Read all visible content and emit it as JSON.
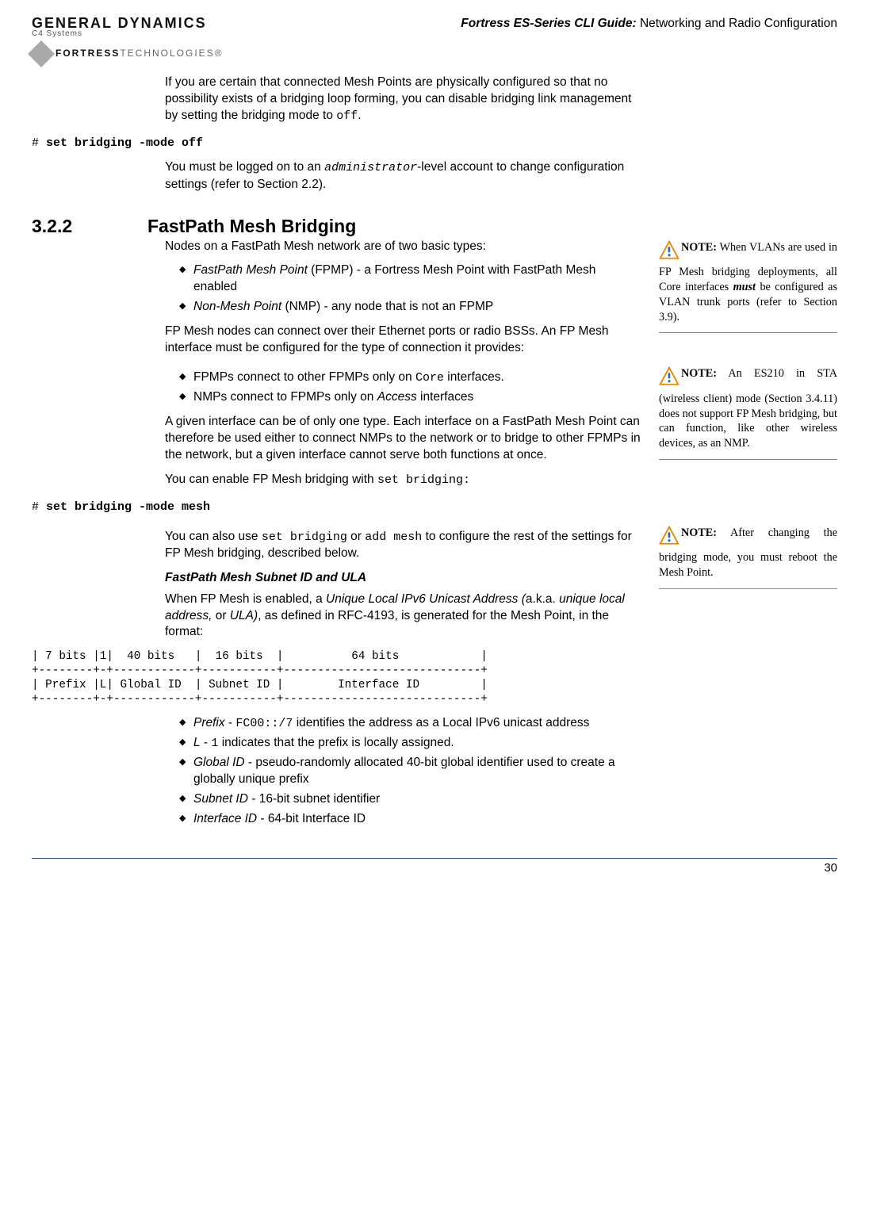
{
  "header": {
    "logo_top": "GENERAL DYNAMICS",
    "logo_sub": "C4 Systems",
    "logo2a": "FORTRESS",
    "logo2b": "TECHNOLOGIES®",
    "title_italic": "Fortress ES-Series CLI Guide:",
    "title_rest": " Networking and Radio Configuration"
  },
  "body": {
    "p1a": "If you are certain that connected Mesh Points are physically configured so that no possibility exists of a bridging loop forming, you can disable bridging link management by setting the bridging mode to ",
    "p1b": "off",
    "p1c": ".",
    "cmd1_prompt": "# ",
    "cmd1_cmd": "set bridging -mode off",
    "p2a": "You must be logged on to an ",
    "p2b": "administrator",
    "p2c": "-level account to change configuration settings (refer to Section 2.2).",
    "secnum": "3.2.2",
    "sectitle": "FastPath Mesh Bridging",
    "p3": "Nodes on a FastPath Mesh network are of two basic types:",
    "li1a": "FastPath Mesh Point",
    "li1b": " (FPMP) - a Fortress Mesh Point with FastPath Mesh enabled",
    "li2a": "Non-Mesh Point",
    "li2b": " (NMP) - any node that is not an FPMP",
    "p4": "FP Mesh nodes can connect over their Ethernet ports or radio BSSs. An FP Mesh interface must be configured for the type of connection it provides:",
    "li3a": "FPMPs connect to other FPMPs only on ",
    "li3b": "Core",
    "li3c": " interfaces.",
    "li4a": "NMPs connect to FPMPs only on ",
    "li4b": "Access",
    "li4c": " interfaces",
    "p5": "A given interface can be of only one type. Each interface on a FastPath Mesh Point can therefore be used either to connect NMPs to the network or to bridge to other FPMPs in the network, but a given interface cannot serve both functions at once.",
    "p6a": "You can enable FP Mesh bridging with ",
    "p6b": "set bridging:",
    "cmd2_prompt": "# ",
    "cmd2_cmd": "set bridging -mode mesh",
    "p7a": "You can also use ",
    "p7b": "set bridging",
    "p7c": " or ",
    "p7d": "add mesh",
    "p7e": " to configure the rest of the settings for FP Mesh bridging, described below.",
    "subhead1": "FastPath Mesh Subnet ID and ULA",
    "p8a": "When FP Mesh is enabled, a ",
    "p8b": "Unique Local IPv6 Unicast Address (",
    "p8c": "a.k.a. ",
    "p8d": "unique local address,",
    "p8e": " or ",
    "p8f": "ULA)",
    "p8g": ", as defined in RFC-4193, is generated for the Mesh Point, in the format:",
    "ascii": "| 7 bits |1|  40 bits   |  16 bits  |          64 bits            |\n+--------+-+------------+-----------+-----------------------------+\n| Prefix |L| Global ID  | Subnet ID |        Interface ID         |\n+--------+-+------------+-----------+-----------------------------+",
    "li5a": "Prefix",
    "li5b": " - ",
    "li5c": "FC00::/7",
    "li5d": " identifies the address as a Local IPv6 unicast address",
    "li6a": "L",
    "li6b": " - ",
    "li6c": "1",
    "li6d": " indicates that the prefix is locally assigned.",
    "li7a": "Global ID",
    "li7b": " - pseudo-randomly allocated 40-bit global identifier used to create a globally unique prefix",
    "li8a": "Subnet ID",
    "li8b": " - 16-bit subnet identifier",
    "li9a": "Interface ID",
    "li9b": " - 64-bit Interface ID"
  },
  "sidenotes": {
    "n1_label": "NOTE:",
    "n1a": " When VLANs are used in FP Mesh bridging deployments, all Core interfaces ",
    "n1b": "must",
    "n1c": " be configured as VLAN trunk ports (refer to Section 3.9).",
    "n2_label": "NOTE:",
    "n2": " An ES210 in STA (wireless client) mode (Section 3.4.11) does not support FP Mesh bridging, but can function, like other wireless devices, as an NMP.",
    "n3_label": "NOTE:",
    "n3": " After changing the bridging mode, you must reboot the Mesh Point."
  },
  "footer": {
    "page": "30"
  }
}
